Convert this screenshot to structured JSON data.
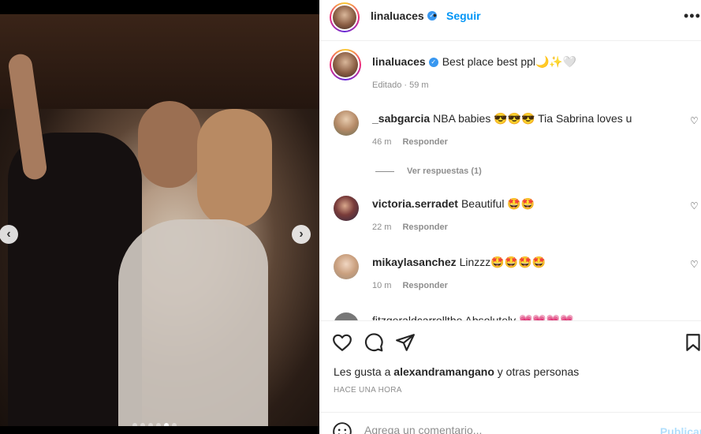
{
  "post": {
    "username": "linaluaces",
    "follow_label": "Seguir",
    "caption": "Best place best ppl🌙✨🤍",
    "caption_meta": "Editado · 59 m"
  },
  "comments": [
    {
      "username": "_sabgarcia",
      "text": "NBA babies 😎😎😎 Tia Sabrina loves u",
      "time": "46 m",
      "reply_label": "Responder"
    },
    {
      "username": "victoria.serradet",
      "text": "Beautiful 🤩🤩",
      "time": "22 m",
      "reply_label": "Responder"
    },
    {
      "username": "mikaylasanchez",
      "text": "Linzzz🤩🤩🤩🤩",
      "time": "10 m",
      "reply_label": "Responder"
    }
  ],
  "see_replies_label": "Ver respuestas (1)",
  "partial_comment": "fitzgeraldcarrollthe Absolutely 💗💗💗💗",
  "likes": {
    "prefix": "Les gusta a",
    "user": "alexandramangano",
    "suffix": "y otras personas"
  },
  "post_time": "HACE UNA HORA",
  "comment_box": {
    "placeholder": "Agrega un comentario...",
    "publish_label": "Publicar"
  },
  "carousel": {
    "total_slides": 6,
    "active_slide": 5
  },
  "colors": {
    "accent": "#0095f6",
    "verified": "#3897f0",
    "text": "#262626",
    "muted": "#8e8e8e"
  }
}
